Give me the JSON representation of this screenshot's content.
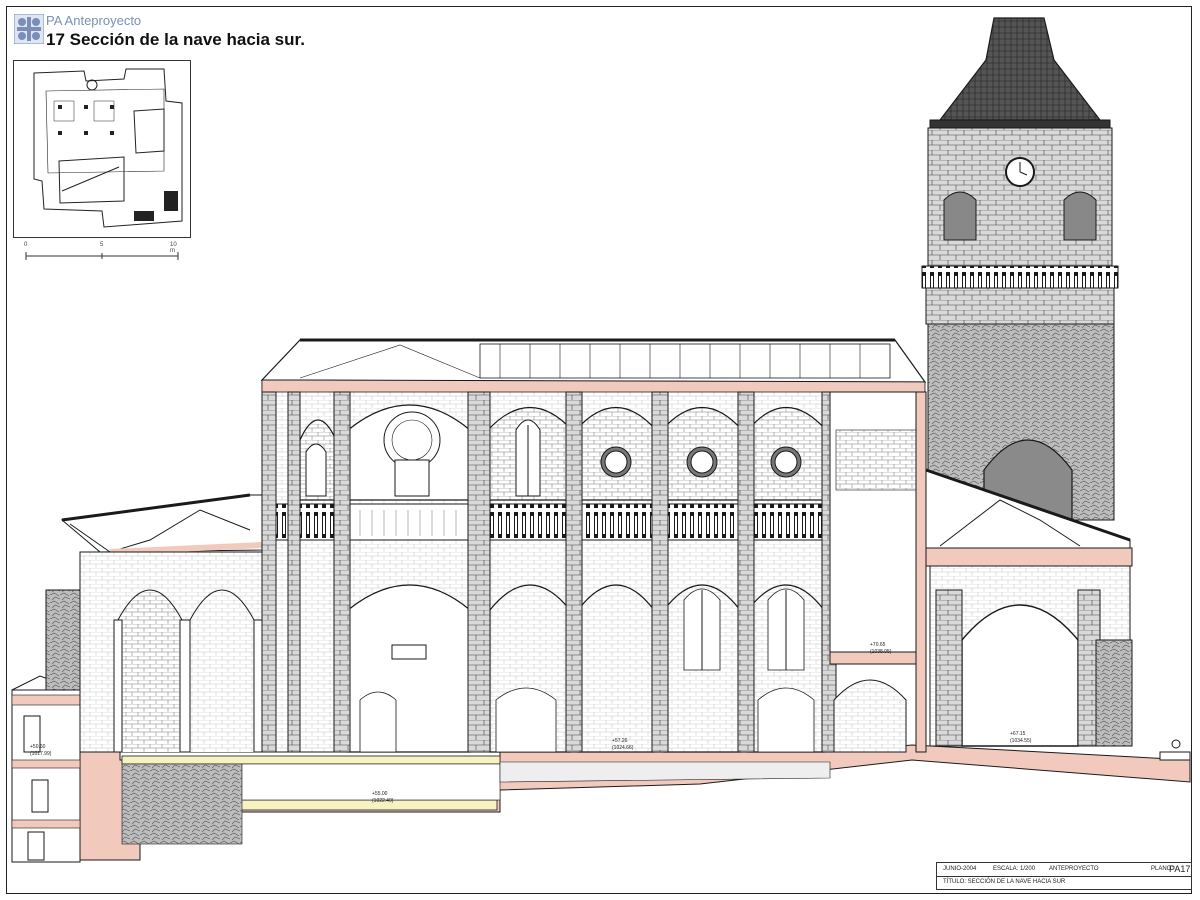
{
  "header": {
    "project": "PA Anteproyecto",
    "title": "17 Sección de la nave hacia sur."
  },
  "keyplan": {
    "scale_labels": [
      "0",
      "5",
      "10 m"
    ]
  },
  "levels": [
    {
      "line1": "+55.00",
      "line2": "(1022.40)"
    },
    {
      "line1": "+57.26",
      "line2": "(1024.66)"
    },
    {
      "line1": "+70.65",
      "line2": "(1038.05)"
    },
    {
      "line1": "+67.15",
      "line2": "(1034.55)"
    },
    {
      "line1": "+50.60",
      "line2": "(1017.99)"
    }
  ],
  "cartouche": {
    "date": "JUNIO-2004",
    "scale": "ESCALA: 1/200",
    "phase": "ANTEPROYECTO",
    "plan_label": "PLANO:",
    "plan_code": "PA17",
    "title_line": "TÍTULO: SECCIÓN DE LA NAVE HACIA SUR"
  },
  "colors": {
    "section_fill": "#f2c9bd",
    "foundation_fill": "#f6f2c2",
    "roof_fill": "#5a5a5a",
    "line": "#1a1a1a",
    "brand": "#7a8fb8"
  }
}
